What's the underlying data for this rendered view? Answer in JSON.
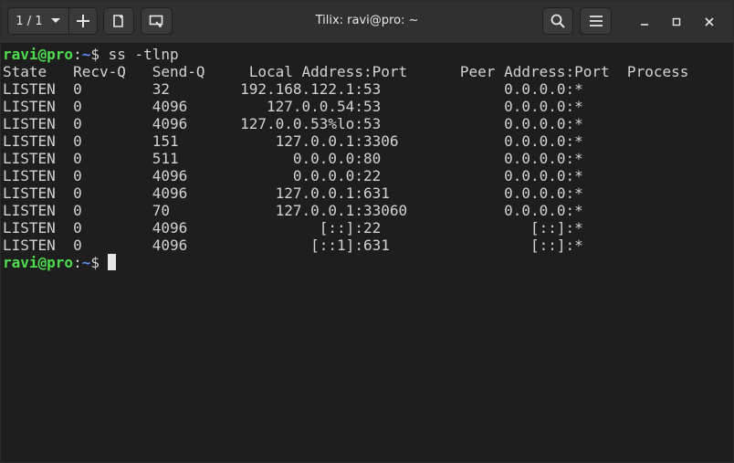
{
  "window": {
    "title": "Tilix: ravi@pro: ~",
    "session_label": "1 / 1"
  },
  "icons": {
    "chevron": "chevron-down-icon",
    "add": "plus-icon",
    "new_session": "new-session-icon",
    "sync_input": "sync-input-icon",
    "search": "search-icon",
    "menu": "hamburger-menu-icon",
    "minimize": "minimize-icon",
    "maximize": "maximize-icon",
    "close": "close-icon"
  },
  "colors": {
    "prompt_user": "#4fdc4f",
    "prompt_path": "#5c8cf0",
    "text": "#d3d3d3",
    "background": "#1e1e1e"
  },
  "terminal": {
    "prompt": {
      "user_host": "ravi@pro",
      "sep": ":",
      "path": "~",
      "symbol": "$"
    },
    "command": " ss -tlnp",
    "output_lines": [
      "State   Recv-Q   Send-Q     Local Address:Port      Peer Address:Port  Process",
      "LISTEN  0        32        192.168.122.1:53              0.0.0.0:*",
      "LISTEN  0        4096         127.0.0.54:53              0.0.0.0:*",
      "LISTEN  0        4096      127.0.0.53%lo:53              0.0.0.0:*",
      "LISTEN  0        151           127.0.0.1:3306            0.0.0.0:*",
      "LISTEN  0        511             0.0.0.0:80              0.0.0.0:*",
      "LISTEN  0        4096            0.0.0.0:22              0.0.0.0:*",
      "LISTEN  0        4096          127.0.0.1:631             0.0.0.0:*",
      "LISTEN  0        70            127.0.0.1:33060           0.0.0.0:*",
      "LISTEN  0        4096               [::]:22                 [::]:*",
      "LISTEN  0        4096              [::1]:631                [::]:*"
    ]
  }
}
